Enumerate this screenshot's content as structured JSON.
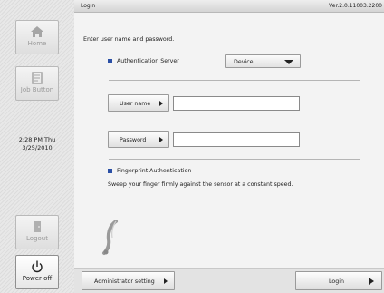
{
  "sidebar": {
    "home_label": "Home",
    "job_button_label": "Job Button",
    "clock_time": "2:28 PM  Thu",
    "clock_date": "3/25/2010",
    "logout_label": "Logout",
    "power_off_label": "Power off"
  },
  "titlebar": {
    "title": "Login",
    "version": "Ver.2.0.11003.2200"
  },
  "main": {
    "instruction": "Enter user name and password.",
    "auth_server_label": "Authentication Server",
    "auth_server_value": "Device",
    "username_button": "User name",
    "username_value": "",
    "password_button": "Password",
    "password_value": "",
    "fingerprint_label": "Fingerprint Authentication",
    "fingerprint_instruction": "Sweep your finger firmly against the sensor at a constant speed."
  },
  "bottom": {
    "admin_setting_label": "Administrator setting",
    "login_label": "Login"
  },
  "colors": {
    "bullet": "#2a4fa5"
  }
}
